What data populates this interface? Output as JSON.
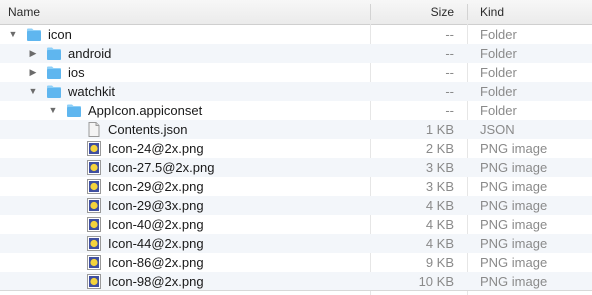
{
  "columns": {
    "name": "Name",
    "size": "Size",
    "kind": "Kind"
  },
  "rows": [
    {
      "name": "icon",
      "size": "--",
      "kind": "Folder",
      "type": "folder",
      "depth": 0,
      "expander": "open"
    },
    {
      "name": "android",
      "size": "--",
      "kind": "Folder",
      "type": "folder",
      "depth": 1,
      "expander": "closed"
    },
    {
      "name": "ios",
      "size": "--",
      "kind": "Folder",
      "type": "folder",
      "depth": 1,
      "expander": "closed"
    },
    {
      "name": "watchkit",
      "size": "--",
      "kind": "Folder",
      "type": "folder",
      "depth": 1,
      "expander": "open"
    },
    {
      "name": "AppIcon.appiconset",
      "size": "--",
      "kind": "Folder",
      "type": "folder",
      "depth": 2,
      "expander": "open"
    },
    {
      "name": "Contents.json",
      "size": "1 KB",
      "kind": "JSON",
      "type": "document",
      "depth": 3,
      "expander": "none"
    },
    {
      "name": "Icon-24@2x.png",
      "size": "2 KB",
      "kind": "PNG image",
      "type": "image",
      "depth": 3,
      "expander": "none"
    },
    {
      "name": "Icon-27.5@2x.png",
      "size": "3 KB",
      "kind": "PNG image",
      "type": "image",
      "depth": 3,
      "expander": "none"
    },
    {
      "name": "Icon-29@2x.png",
      "size": "3 KB",
      "kind": "PNG image",
      "type": "image",
      "depth": 3,
      "expander": "none"
    },
    {
      "name": "Icon-29@3x.png",
      "size": "4 KB",
      "kind": "PNG image",
      "type": "image",
      "depth": 3,
      "expander": "none"
    },
    {
      "name": "Icon-40@2x.png",
      "size": "4 KB",
      "kind": "PNG image",
      "type": "image",
      "depth": 3,
      "expander": "none"
    },
    {
      "name": "Icon-44@2x.png",
      "size": "4 KB",
      "kind": "PNG image",
      "type": "image",
      "depth": 3,
      "expander": "none"
    },
    {
      "name": "Icon-86@2x.png",
      "size": "9 KB",
      "kind": "PNG image",
      "type": "image",
      "depth": 3,
      "expander": "none"
    },
    {
      "name": "Icon-98@2x.png",
      "size": "10 KB",
      "kind": "PNG image",
      "type": "image",
      "depth": 3,
      "expander": "none"
    }
  ],
  "colors": {
    "folder": "#5fb6ef",
    "folder_tab": "#8fd0f8",
    "image_frame": "#3f4fa0",
    "image_dot": "#f4d33c",
    "row_alt": "#f3f6fa"
  }
}
